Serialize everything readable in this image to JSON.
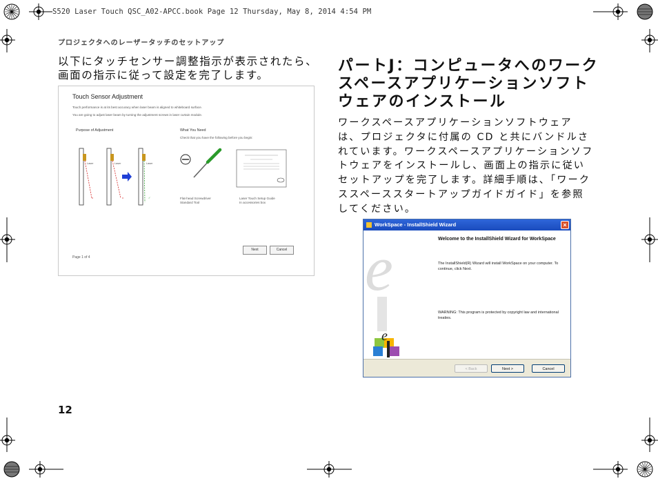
{
  "file_header": "S520 Laser Touch QSC_A02-APCC.book  Page 12  Thursday, May 8, 2014  4:54 PM",
  "running_head": "プロジェクタへのレーザータッチのセットアップ",
  "left_paragraph": "以下にタッチセンサー調整指示が表示されたら、画面の指示に従って設定を完了します。",
  "section_heading": "パートJ：コンピュータへのワークスペースアプリケーションソフトウェアのインストール",
  "section_body": "ワークスペースアプリケーションソフトウェアは、プロジェクタに付属の CD と共にバンドルされています。ワークスペースアプリケーションソフトウェアをインストールし、画面上の指示に従いセットアップを完了します。詳細手順は、「ワークススペーススタートアップガイドガイド」を参照してください。",
  "page_number": "12",
  "touch_sensor_screen": {
    "title": "Touch Sensor Adjustment",
    "line1": "Touch performance is at its best accuracy when laser beam is aligned to whiteboard surface.",
    "line2": "You are going to adjust laser beam by turning the adjustment screws in laser curtain module.",
    "purpose_heading": "Purpose of Adjustment",
    "need_heading": "What You Need",
    "need_text": "Check that you have the following before you begin:",
    "laser_label": "Laser",
    "tool1_line1": "Flat-head Screwdriver",
    "tool1_line2": "Standard Tool",
    "tool2_line1": "Laser Touch Setup Guide",
    "tool2_line2": "In accessories box",
    "page_indicator": "Page 1 of 4",
    "next_label": "Next",
    "cancel_label": "Cancel",
    "colors": {
      "accent_blue": "#1f3fd6",
      "mount_yellow": "#c8961e",
      "beam_red": "#d22020",
      "ok_green": "#2a9a2a"
    }
  },
  "installshield_screen": {
    "window_title": "WorkSpace - InstallShield Wizard",
    "welcome_heading": "Welcome to the InstallShield Wizard for WorkSpace",
    "welcome_text": "The InstallShield(R) Wizard will install WorkSpace on your computer. To continue, click Next.",
    "warning_text": "WARNING: This program is protected by copyright law and international treaties.",
    "back_label": "< Back",
    "next_label": "Next >",
    "cancel_label": "Cancel",
    "colors": {
      "titlebar_blue": "#2456c9",
      "close_red": "#d9512c"
    }
  }
}
